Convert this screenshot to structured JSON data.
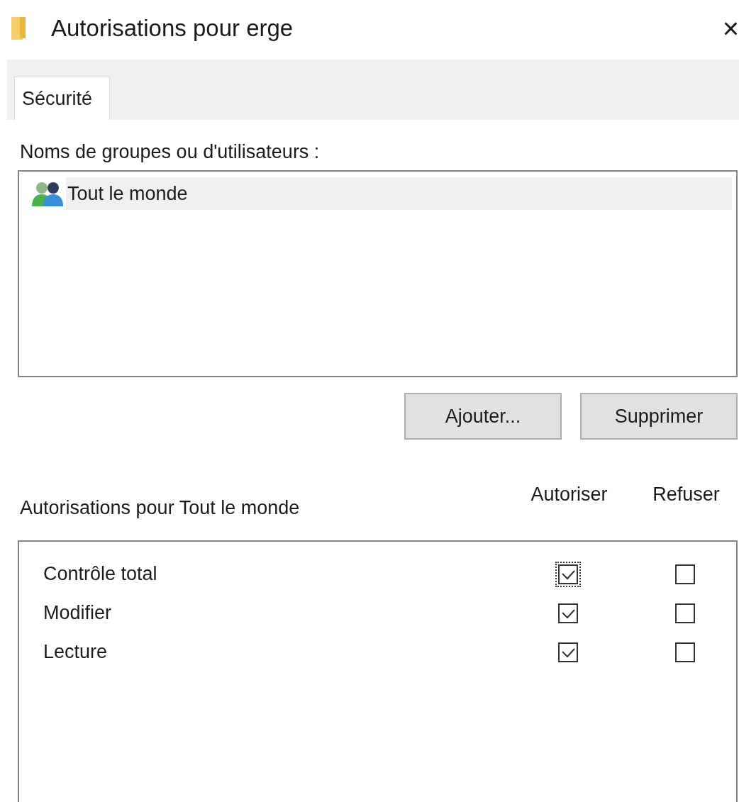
{
  "window": {
    "title": "Autorisations pour erge",
    "close": "×"
  },
  "tabs": [
    {
      "label": "Sécurité",
      "selected": true
    }
  ],
  "groups": {
    "label": "Noms de groupes ou d'utilisateurs :",
    "items": [
      {
        "name": "Tout le monde",
        "selected": true
      }
    ]
  },
  "buttons": [
    "Ajouter...",
    "Supprimer"
  ],
  "permissions": {
    "label": "Autorisations pour Tout le monde",
    "columns": [
      "Autoriser",
      "Refuser"
    ],
    "rows": [
      {
        "name": "Contrôle total",
        "allow": {
          "checked": true,
          "focused": true
        },
        "deny": {
          "checked": false,
          "focused": false
        }
      },
      {
        "name": "Modifier",
        "allow": {
          "checked": true,
          "focused": false
        },
        "deny": {
          "checked": false,
          "focused": false
        }
      },
      {
        "name": "Lecture",
        "allow": {
          "checked": true,
          "focused": false
        },
        "deny": {
          "checked": false,
          "focused": false
        }
      }
    ]
  }
}
